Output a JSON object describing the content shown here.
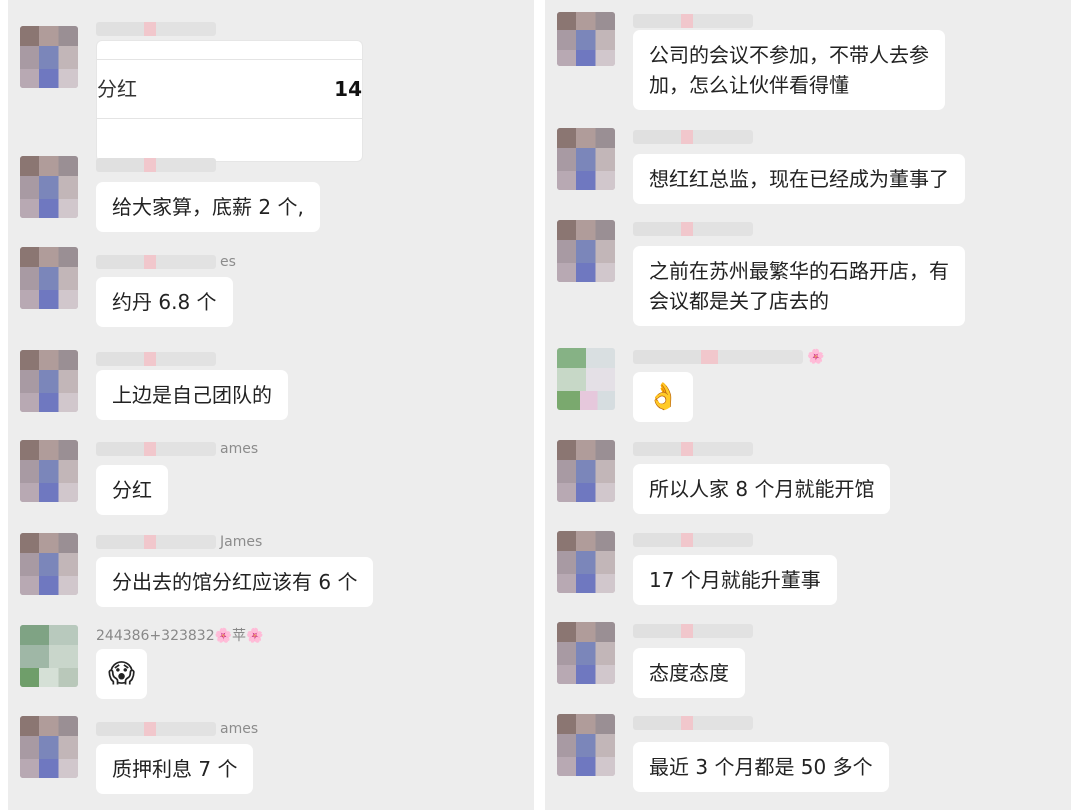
{
  "left": {
    "messages": [
      {
        "name": "",
        "card": {
          "label": "分红",
          "value": "14"
        }
      },
      {
        "name": "",
        "text": "给大家算，底薪 2 个,"
      },
      {
        "name": "es",
        "text": "约丹 6.8 个"
      },
      {
        "name": "",
        "text": "上边是自己团队的"
      },
      {
        "name": "ames",
        "text": "分红"
      },
      {
        "name": "James",
        "text": "分出去的馆分红应该有 6 个"
      },
      {
        "name": "244386+323832🌸苹🌸",
        "text": "😱"
      },
      {
        "name": "ames",
        "text": "质押利息 7 个"
      }
    ]
  },
  "right": {
    "messages": [
      {
        "name": "",
        "line1": "公司的会议不参加，不带人去参",
        "line2": "加，怎么让伙伴看得懂"
      },
      {
        "name": "",
        "text": "想红红总监，现在已经成为董事了"
      },
      {
        "name": "",
        "line1": "之前在苏州最繁华的石路开店，有",
        "line2": "会议都是关了店去的"
      },
      {
        "name": "🌸",
        "text": "👌"
      },
      {
        "name": "",
        "text": "所以人家 8 个月就能开馆"
      },
      {
        "name": "",
        "text": "17 个月就能升董事"
      },
      {
        "name": "",
        "text": "态度态度"
      },
      {
        "name": "",
        "text": "最近 3 个月都是 50 多个"
      }
    ]
  }
}
